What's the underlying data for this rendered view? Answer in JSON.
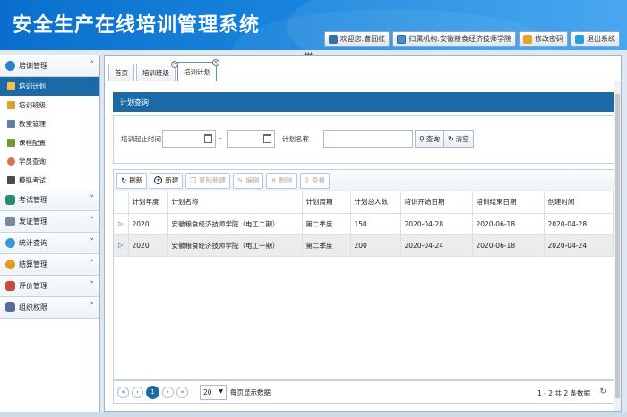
{
  "header": {
    "title": "安全生产在线培训管理系统",
    "welcome": "欢迎您:曹囧红",
    "org": "归属机构:安徽粮食经济技师学院",
    "change_password": "修改密码",
    "logout": "退出系统"
  },
  "sidebar": {
    "groups": [
      {
        "label": "培训管理",
        "expanded": true,
        "items": [
          {
            "label": "培训计划",
            "active": true
          },
          {
            "label": "培训班级"
          },
          {
            "label": "教室管理"
          },
          {
            "label": "课程配置"
          },
          {
            "label": "学员查询"
          },
          {
            "label": "模拟考试"
          }
        ]
      },
      {
        "label": "考试管理"
      },
      {
        "label": "发证管理"
      },
      {
        "label": "统计查询"
      },
      {
        "label": "结算管理"
      },
      {
        "label": "评价管理"
      },
      {
        "label": "组织权限"
      }
    ]
  },
  "tabs": [
    {
      "label": "首页"
    },
    {
      "label": "培训班级",
      "closable": true
    },
    {
      "label": "培训计划",
      "closable": true,
      "active": true
    }
  ],
  "panel": {
    "title": "计划查询"
  },
  "search": {
    "date_label": "培训起止时间",
    "date_start": "",
    "date_sep": "-",
    "date_end": "",
    "name_label": "计划名称",
    "name_value": "",
    "search_btn": "查询",
    "clear_btn": "清空"
  },
  "toolbar": {
    "refresh": "刷新",
    "add": "新建",
    "copy_add": "复制新建",
    "edit": "编辑",
    "delete": "删除",
    "view": "查看"
  },
  "table": {
    "columns": [
      "计划年度",
      "计划名称",
      "计划周期",
      "计划总人数",
      "培训开始日期",
      "培训结束日期",
      "创建时间"
    ],
    "rows": [
      [
        "2020",
        "安徽粮食经济技师学院（电工二期）",
        "第二季度",
        "150",
        "2020-04-28",
        "2020-06-18",
        "2020-04-28"
      ],
      [
        "2020",
        "安徽粮食经济技师学院（电工一期）",
        "第二季度",
        "200",
        "2020-04-24",
        "2020-06-18",
        "2020-04-24"
      ]
    ]
  },
  "pager": {
    "first": "«",
    "prev": "‹",
    "current": "1",
    "next": "›",
    "last": "»",
    "page_size": "20",
    "page_size_label": "每页显示数据",
    "info": "1 - 2 共 2 条数据"
  },
  "colors": {
    "header": "#1a88e0",
    "accent": "#1b6aa6"
  }
}
